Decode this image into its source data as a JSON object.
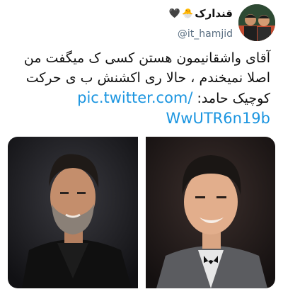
{
  "author": {
    "display_name": "قندارک",
    "emoji_1": "🐣",
    "emoji_2": "🖤",
    "handle": "@it_hamjid",
    "avatar_icon": "profile-photo-two-men"
  },
  "tweet": {
    "line1": "آقای واشقانیمون هستن کسی ک میگفت من",
    "line2": "اصلا نمیخندم ، حالا ری اکشنش ب ی حرکت",
    "line3_text": "کوچیک حامد:",
    "link_part1": "pic.twitter.com/",
    "link_part2": "WwUTR6n19b"
  },
  "media": {
    "photos": [
      {
        "name": "bearded-man-photo"
      },
      {
        "name": "smiling-man-photo"
      }
    ]
  },
  "colors": {
    "link": "#1b95e0",
    "handle": "#5b7083"
  }
}
